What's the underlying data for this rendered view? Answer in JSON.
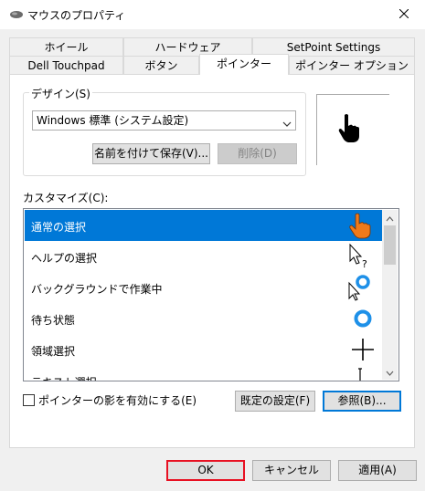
{
  "window": {
    "title": "マウスのプロパティ"
  },
  "tabs_row1": [
    {
      "label": "ホイール"
    },
    {
      "label": "ハードウェア"
    },
    {
      "label": "SetPoint Settings"
    }
  ],
  "tabs_row2": [
    {
      "label": "Dell Touchpad"
    },
    {
      "label": "ボタン"
    },
    {
      "label": "ポインター",
      "active": true
    },
    {
      "label": "ポインター オプション"
    }
  ],
  "design": {
    "group_label": "デザイン(S)",
    "scheme_value": "Windows 標準 (システム設定)",
    "save_as_label": "名前を付けて保存(V)...",
    "delete_label": "削除(D)"
  },
  "customize": {
    "label": "カスタマイズ(C):",
    "items": [
      {
        "label": "通常の選択",
        "icon": "hand-pointer-icon",
        "selected": true
      },
      {
        "label": "ヘルプの選択",
        "icon": "help-select-icon"
      },
      {
        "label": "バックグラウンドで作業中",
        "icon": "working-in-background-icon"
      },
      {
        "label": "待ち状態",
        "icon": "busy-ring-icon"
      },
      {
        "label": "領域選択",
        "icon": "precision-crosshair-icon"
      },
      {
        "label": "テキスト選択",
        "icon": "text-ibeam-icon"
      }
    ]
  },
  "shadow_checkbox": {
    "label": "ポインターの影を有効にする(E)",
    "checked": false
  },
  "buttons": {
    "use_default": "既定の設定(F)",
    "browse": "参照(B)...",
    "ok": "OK",
    "cancel": "キャンセル",
    "apply": "適用(A)"
  },
  "colors": {
    "selection": "#0078d7",
    "hand_cursor": "#f07a1a",
    "busy_ring": "#1e90e8",
    "ok_border": "#e81123"
  }
}
